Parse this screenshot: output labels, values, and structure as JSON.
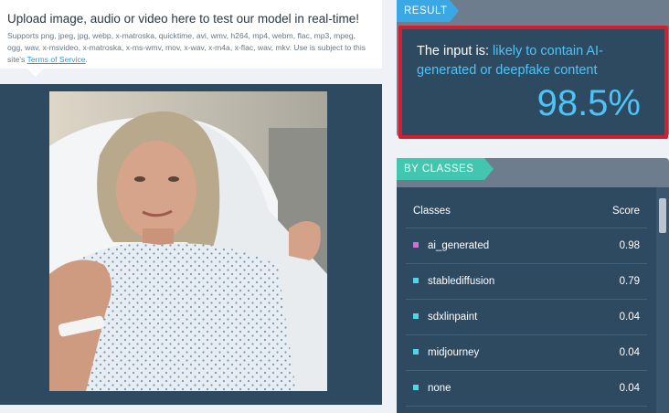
{
  "upload": {
    "title": "Upload image, audio or video here to test our model in real-time!",
    "supported_formats": "Supports png, jpeg, jpg, webp, x-matroska, quicktime, avi, wmv, h264, mp4, webm, flac, mp3, mpeg, ogg, wav, x-msvideo, x-matroska, x-ms-wmv, mov, x-wav, x-m4a, x-flac, wav, mkv. Use is subject to this site's",
    "terms_link": "Terms of Service",
    "terms_suffix": "."
  },
  "result": {
    "tag": "RESULT",
    "prefix": "The input is: ",
    "verdict": "likely to contain AI-generated or deepfake content",
    "percent": "98.5%"
  },
  "classes": {
    "tag": "BY CLASSES",
    "col_classes": "Classes",
    "col_score": "Score",
    "rows": [
      {
        "name": "ai_generated",
        "score": "0.98",
        "color": "#d36fd9"
      },
      {
        "name": "stablediffusion",
        "score": "0.79",
        "color": "#4fd6e8"
      },
      {
        "name": "sdxlinpaint",
        "score": "0.04",
        "color": "#4fd6e8"
      },
      {
        "name": "midjourney",
        "score": "0.04",
        "color": "#4fd6e8"
      },
      {
        "name": "none",
        "score": "0.04",
        "color": "#4fd6e8"
      }
    ]
  },
  "colors": {
    "accent": "#4fc3f7",
    "result_tag": "#3aa8e4",
    "classes_tag": "#43c6b0",
    "highlight_border": "#d21f2f",
    "panel": "#2e4a61"
  }
}
